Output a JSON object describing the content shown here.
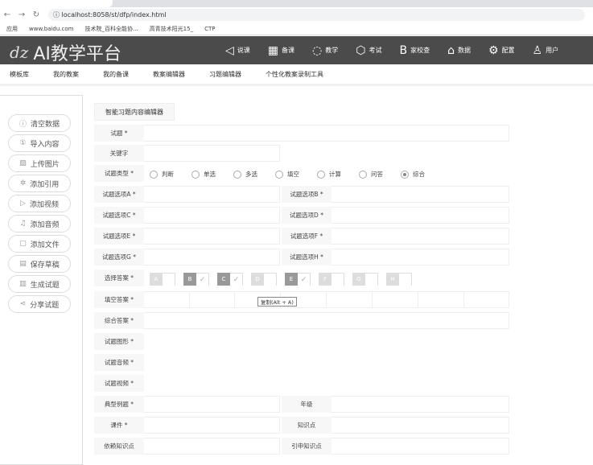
{
  "browser": {
    "url": "localhost:8058/st/dfp/index.html",
    "bookmarks": [
      "应用",
      "www.baidu.com",
      "技术院_百科全能协...",
      "高青技术阳光15_",
      "CTP"
    ]
  },
  "header": {
    "logo": "AI教学平台",
    "nav": [
      {
        "label": "说课",
        "icon": "paper-plane-icon",
        "glyph": "◁"
      },
      {
        "label": "备课",
        "icon": "calendar-icon",
        "glyph": "▦"
      },
      {
        "label": "教学",
        "icon": "dial-icon",
        "glyph": "◌"
      },
      {
        "label": "考试",
        "icon": "cube-icon",
        "glyph": "⬡"
      },
      {
        "label": "家校查",
        "icon": "bold-b-icon",
        "glyph": "B"
      },
      {
        "label": "数据",
        "icon": "bag-icon",
        "glyph": "⌂"
      },
      {
        "label": "配置",
        "icon": "gear-icon",
        "glyph": "⚙"
      },
      {
        "label": "用户",
        "icon": "user-icon",
        "glyph": "♙"
      }
    ]
  },
  "subnav": [
    "模板库",
    "我的教案",
    "我的备课",
    "教案编辑器",
    "习题编辑器",
    "个性化教案录制工具"
  ],
  "sidebar": [
    {
      "label": "清空数据",
      "glyph": "ⓘ"
    },
    {
      "label": "导入内容",
      "glyph": "①"
    },
    {
      "label": "上传图片",
      "glyph": "▨"
    },
    {
      "label": "添加引用",
      "glyph": "✲"
    },
    {
      "label": "添加视频",
      "glyph": "▷"
    },
    {
      "label": "添加音频",
      "glyph": "♫"
    },
    {
      "label": "添加文件",
      "glyph": "▢"
    },
    {
      "label": "保存草稿",
      "glyph": "▤"
    },
    {
      "label": "生成试题",
      "glyph": "▥"
    },
    {
      "label": "分享试题",
      "glyph": "⋖"
    }
  ],
  "form": {
    "title": "智能习题内容编辑器",
    "labels": {
      "question": "试题 *",
      "keyword": "关键字",
      "type": "试题类型 *",
      "optA": "试题选项A *",
      "optB": "试题选项B *",
      "optC": "试题选项C *",
      "optD": "试题选项D *",
      "optE": "试题选项E *",
      "optF": "试题选项F *",
      "optG": "试题选项G *",
      "optH": "试题选项H *",
      "choice": "选择答案 *",
      "fill": "填空答案 *",
      "comprehensive": "综合答案 *",
      "graphic": "试题图形 *",
      "audio": "试题音频 *",
      "video": "试题视频 *",
      "example": "典型例题 *",
      "grade": "年级",
      "courseware": "课件 *",
      "knowledge": "知识点",
      "dependKnowledge": "依赖知识点",
      "extendKnowledge": "引申知识点"
    },
    "types": [
      "判断",
      "单选",
      "多选",
      "填空",
      "计算",
      "问答",
      "综合"
    ],
    "selectedType": "综合",
    "answers": [
      {
        "l": "A",
        "c": false
      },
      {
        "l": "B",
        "c": true
      },
      {
        "l": "C",
        "c": true
      },
      {
        "l": "D",
        "c": false
      },
      {
        "l": "E",
        "c": true
      },
      {
        "l": "F",
        "c": false
      },
      {
        "l": "G",
        "c": false
      },
      {
        "l": "H",
        "c": false
      }
    ],
    "check": "✓",
    "tooltip": "复制(Alt + A)"
  }
}
